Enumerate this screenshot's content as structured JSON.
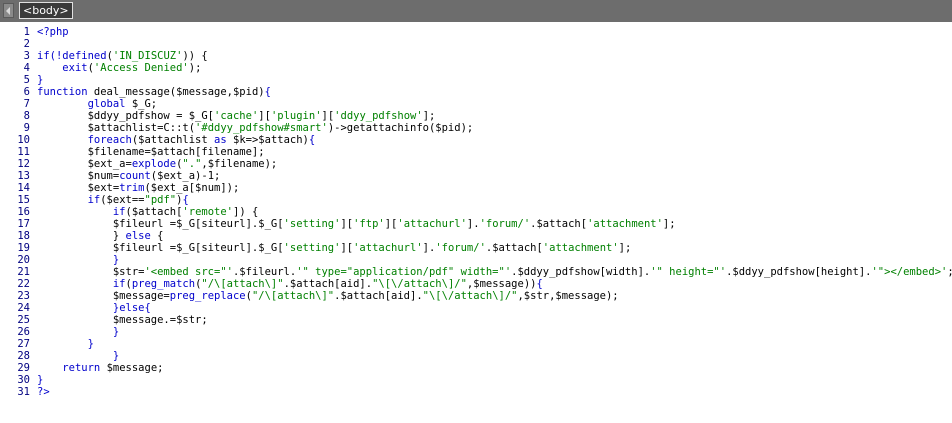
{
  "tagbar": {
    "tag": "<body>"
  },
  "lines": [
    {
      "n": "1",
      "segs": [
        {
          "t": "<?php",
          "c": "k"
        }
      ]
    },
    {
      "n": "2",
      "segs": []
    },
    {
      "n": "3",
      "segs": [
        {
          "t": "if(!",
          "c": "k"
        },
        {
          "t": "defined",
          "c": "f"
        },
        {
          "t": "(",
          "c": "p"
        },
        {
          "t": "'IN_DISCUZ'",
          "c": "s"
        },
        {
          "t": ")) {",
          "c": "p"
        }
      ]
    },
    {
      "n": "4",
      "segs": [
        {
          "t": "    ",
          "c": "p"
        },
        {
          "t": "exit",
          "c": "f"
        },
        {
          "t": "(",
          "c": "p"
        },
        {
          "t": "'Access Denied'",
          "c": "s"
        },
        {
          "t": ");",
          "c": "p"
        }
      ]
    },
    {
      "n": "5",
      "segs": [
        {
          "t": "}",
          "c": "k"
        }
      ]
    },
    {
      "n": "6",
      "segs": [
        {
          "t": "function ",
          "c": "k"
        },
        {
          "t": "deal_message($message,$pid)",
          "c": "v"
        },
        {
          "t": "{",
          "c": "k"
        }
      ]
    },
    {
      "n": "7",
      "segs": [
        {
          "t": "        ",
          "c": "p"
        },
        {
          "t": "global ",
          "c": "k"
        },
        {
          "t": "$_G;",
          "c": "v"
        }
      ]
    },
    {
      "n": "8",
      "segs": [
        {
          "t": "        $ddyy_pdfshow = $_G[",
          "c": "v"
        },
        {
          "t": "'cache'",
          "c": "s"
        },
        {
          "t": "][",
          "c": "v"
        },
        {
          "t": "'plugin'",
          "c": "s"
        },
        {
          "t": "][",
          "c": "v"
        },
        {
          "t": "'ddyy_pdfshow'",
          "c": "s"
        },
        {
          "t": "];",
          "c": "v"
        }
      ]
    },
    {
      "n": "9",
      "segs": [
        {
          "t": "        $attachlist=C::t(",
          "c": "v"
        },
        {
          "t": "'#ddyy_pdfshow#smart'",
          "c": "s"
        },
        {
          "t": ")->getattachinfo($pid);",
          "c": "v"
        }
      ]
    },
    {
      "n": "10",
      "segs": [
        {
          "t": "        ",
          "c": "p"
        },
        {
          "t": "foreach",
          "c": "k"
        },
        {
          "t": "($attachlist ",
          "c": "v"
        },
        {
          "t": "as",
          "c": "k"
        },
        {
          "t": " $k=>$attach)",
          "c": "v"
        },
        {
          "t": "{",
          "c": "k"
        }
      ]
    },
    {
      "n": "11",
      "segs": [
        {
          "t": "        $filename=$attach[filename];",
          "c": "v"
        }
      ]
    },
    {
      "n": "12",
      "segs": [
        {
          "t": "        $ext_a=",
          "c": "v"
        },
        {
          "t": "explode",
          "c": "f"
        },
        {
          "t": "(",
          "c": "v"
        },
        {
          "t": "\".\"",
          "c": "s"
        },
        {
          "t": ",$filename);",
          "c": "v"
        }
      ]
    },
    {
      "n": "13",
      "segs": [
        {
          "t": "        $num=",
          "c": "v"
        },
        {
          "t": "count",
          "c": "f"
        },
        {
          "t": "($ext_a)-1;",
          "c": "v"
        }
      ]
    },
    {
      "n": "14",
      "segs": [
        {
          "t": "        $ext=",
          "c": "v"
        },
        {
          "t": "trim",
          "c": "f"
        },
        {
          "t": "($ext_a[$num]);",
          "c": "v"
        }
      ]
    },
    {
      "n": "15",
      "segs": [
        {
          "t": "        ",
          "c": "p"
        },
        {
          "t": "if",
          "c": "k"
        },
        {
          "t": "($ext==",
          "c": "v"
        },
        {
          "t": "\"pdf\"",
          "c": "s"
        },
        {
          "t": ")",
          "c": "v"
        },
        {
          "t": "{",
          "c": "k"
        }
      ]
    },
    {
      "n": "16",
      "segs": [
        {
          "t": "            ",
          "c": "p"
        },
        {
          "t": "if",
          "c": "k"
        },
        {
          "t": "($attach[",
          "c": "v"
        },
        {
          "t": "'remote'",
          "c": "s"
        },
        {
          "t": "]) {",
          "c": "v"
        }
      ]
    },
    {
      "n": "17",
      "segs": [
        {
          "t": "            $fileurl =$_G[siteurl].$_G[",
          "c": "v"
        },
        {
          "t": "'setting'",
          "c": "s"
        },
        {
          "t": "][",
          "c": "v"
        },
        {
          "t": "'ftp'",
          "c": "s"
        },
        {
          "t": "][",
          "c": "v"
        },
        {
          "t": "'attachurl'",
          "c": "s"
        },
        {
          "t": "].",
          "c": "v"
        },
        {
          "t": "'forum/'",
          "c": "s"
        },
        {
          "t": ".$attach[",
          "c": "v"
        },
        {
          "t": "'attachment'",
          "c": "s"
        },
        {
          "t": "];",
          "c": "v"
        }
      ]
    },
    {
      "n": "18",
      "segs": [
        {
          "t": "            } ",
          "c": "v"
        },
        {
          "t": "else",
          "c": "k"
        },
        {
          "t": " {",
          "c": "v"
        }
      ]
    },
    {
      "n": "19",
      "segs": [
        {
          "t": "            $fileurl =$_G[siteurl].$_G[",
          "c": "v"
        },
        {
          "t": "'setting'",
          "c": "s"
        },
        {
          "t": "][",
          "c": "v"
        },
        {
          "t": "'attachurl'",
          "c": "s"
        },
        {
          "t": "].",
          "c": "v"
        },
        {
          "t": "'forum/'",
          "c": "s"
        },
        {
          "t": ".$attach[",
          "c": "v"
        },
        {
          "t": "'attachment'",
          "c": "s"
        },
        {
          "t": "];",
          "c": "v"
        }
      ]
    },
    {
      "n": "20",
      "segs": [
        {
          "t": "            }",
          "c": "k"
        }
      ]
    },
    {
      "n": "21",
      "segs": [
        {
          "t": "            $str=",
          "c": "v"
        },
        {
          "t": "'<embed src=\"'",
          "c": "s"
        },
        {
          "t": ".$fileurl.",
          "c": "v"
        },
        {
          "t": "'\" type=\"application/pdf\" width=\"'",
          "c": "s"
        },
        {
          "t": ".$ddyy_pdfshow[width].",
          "c": "v"
        },
        {
          "t": "'\" height=\"'",
          "c": "s"
        },
        {
          "t": ".$ddyy_pdfshow[height].",
          "c": "v"
        },
        {
          "t": "'\"></embed>'",
          "c": "s"
        },
        {
          "t": ";",
          "c": "v"
        }
      ]
    },
    {
      "n": "22",
      "segs": [
        {
          "t": "            ",
          "c": "p"
        },
        {
          "t": "if",
          "c": "k"
        },
        {
          "t": "(",
          "c": "v"
        },
        {
          "t": "preg_match",
          "c": "f"
        },
        {
          "t": "(",
          "c": "v"
        },
        {
          "t": "\"/\\[attach\\]\"",
          "c": "s"
        },
        {
          "t": ".$attach[aid].",
          "c": "v"
        },
        {
          "t": "\"\\[\\/attach\\]/\"",
          "c": "s"
        },
        {
          "t": ",$message))",
          "c": "v"
        },
        {
          "t": "{",
          "c": "k"
        }
      ]
    },
    {
      "n": "23",
      "segs": [
        {
          "t": "            $message=",
          "c": "v"
        },
        {
          "t": "preg_replace",
          "c": "f"
        },
        {
          "t": "(",
          "c": "v"
        },
        {
          "t": "\"/\\[attach\\]\"",
          "c": "s"
        },
        {
          "t": ".$attach[aid].",
          "c": "v"
        },
        {
          "t": "\"\\[\\/attach\\]/\"",
          "c": "s"
        },
        {
          "t": ",$str,$message);",
          "c": "v"
        }
      ]
    },
    {
      "n": "24",
      "segs": [
        {
          "t": "            }",
          "c": "k"
        },
        {
          "t": "else",
          "c": "k"
        },
        {
          "t": "{",
          "c": "k"
        }
      ]
    },
    {
      "n": "25",
      "segs": [
        {
          "t": "            $message.=$str;",
          "c": "v"
        }
      ]
    },
    {
      "n": "26",
      "segs": [
        {
          "t": "            }",
          "c": "k"
        }
      ]
    },
    {
      "n": "27",
      "segs": [
        {
          "t": "        }",
          "c": "k"
        }
      ]
    },
    {
      "n": "28",
      "segs": [
        {
          "t": "            }",
          "c": "k"
        }
      ]
    },
    {
      "n": "29",
      "segs": [
        {
          "t": "    ",
          "c": "p"
        },
        {
          "t": "return ",
          "c": "k"
        },
        {
          "t": "$message;",
          "c": "v"
        }
      ]
    },
    {
      "n": "30",
      "segs": [
        {
          "t": "}",
          "c": "k"
        }
      ]
    },
    {
      "n": "31",
      "segs": [
        {
          "t": "?>",
          "c": "k"
        }
      ]
    }
  ]
}
